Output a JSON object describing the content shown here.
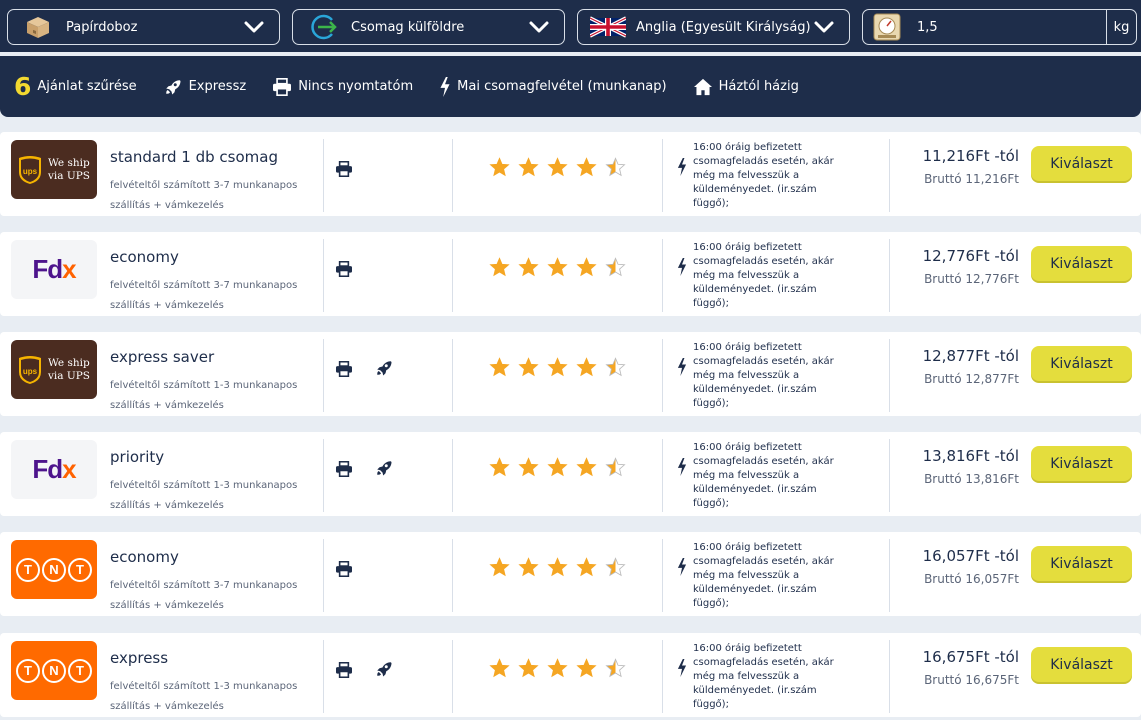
{
  "selectors": {
    "package_type": {
      "label": "Papírdoboz",
      "icon": "box-icon"
    },
    "route": {
      "label": "Csomag külföldre",
      "icon": "arrow-circle-icon"
    },
    "destination": {
      "label": "Anglia (Egyesült Királyság)",
      "icon": "uk-flag-icon"
    },
    "weight": {
      "value": "1,5",
      "unit": "kg",
      "icon": "scale-icon"
    }
  },
  "filters": {
    "count": "6",
    "title": "Ajánlat szűrése",
    "items": [
      {
        "label": "Expressz",
        "icon": "rocket-icon"
      },
      {
        "label": "Nincs nyomtatóm",
        "icon": "printer-icon"
      },
      {
        "label": "Mai csomagfelvétel (munkanap)",
        "icon": "bolt-icon"
      },
      {
        "label": "Háztól házig",
        "icon": "home-icon"
      }
    ]
  },
  "offers": [
    {
      "carrier": "UPS",
      "service": "standard 1 db csomag",
      "desc1": "felvételtől számított 3-7 munkanapos",
      "desc2": "szállítás + vámkezelés",
      "express": false,
      "rating": 4.5,
      "pickup": "16:00 óráig befizetett csomagfeladás esetén, akár még ma felvesszük a küldeményedet. (ir.szám függő);",
      "price": "11,216Ft -tól",
      "gross": "Bruttó 11,216Ft",
      "button": "Kiválaszt"
    },
    {
      "carrier": "FedEx",
      "service": "economy",
      "desc1": "felvételtől számított 3-7 munkanapos",
      "desc2": "szállítás + vámkezelés",
      "express": false,
      "rating": 4.5,
      "pickup": "16:00 óráig befizetett csomagfeladás esetén, akár még ma felvesszük a küldeményedet. (ir.szám függő);",
      "price": "12,776Ft -tól",
      "gross": "Bruttó 12,776Ft",
      "button": "Kiválaszt"
    },
    {
      "carrier": "UPS",
      "service": "express saver",
      "desc1": "felvételtől számított 1-3 munkanapos",
      "desc2": "szállítás + vámkezelés",
      "express": true,
      "rating": 4.5,
      "pickup": "16:00 óráig befizetett csomagfeladás esetén, akár még ma felvesszük a küldeményedet. (ir.szám függő);",
      "price": "12,877Ft -tól",
      "gross": "Bruttó 12,877Ft",
      "button": "Kiválaszt"
    },
    {
      "carrier": "FedEx",
      "service": "priority",
      "desc1": "felvételtől számított 1-3 munkanapos",
      "desc2": "szállítás + vámkezelés",
      "express": true,
      "rating": 4.5,
      "pickup": "16:00 óráig befizetett csomagfeladás esetén, akár még ma felvesszük a küldeményedet. (ir.szám függő);",
      "price": "13,816Ft -tól",
      "gross": "Bruttó 13,816Ft",
      "button": "Kiválaszt"
    },
    {
      "carrier": "TNT",
      "service": "economy",
      "desc1": "felvételtől számított 3-7 munkanapos",
      "desc2": "szállítás + vámkezelés",
      "express": false,
      "rating": 4.5,
      "pickup": "16:00 óráig befizetett csomagfeladás esetén, akár még ma felvesszük a küldeményedet. (ir.szám függő);",
      "price": "16,057Ft -tól",
      "gross": "Bruttó 16,057Ft",
      "button": "Kiválaszt"
    },
    {
      "carrier": "TNT",
      "service": "express",
      "desc1": "felvételtől számított 1-3 munkanapos",
      "desc2": "szállítás + vámkezelés",
      "express": true,
      "rating": 4.5,
      "pickup": "16:00 óráig befizetett csomagfeladás esetén, akár még ma felvesszük a küldeményedet. (ir.szám függő);",
      "price": "16,675Ft -tól",
      "gross": "Bruttó 16,675Ft",
      "button": "Kiválaszt"
    }
  ],
  "logos": {
    "ups_text_1": "We ship",
    "ups_text_2": "via UPS",
    "ups_shield": "ups",
    "fdx_fd": "Fd",
    "fdx_x": "x",
    "tnt": [
      "T",
      "N",
      "T"
    ]
  },
  "colors": {
    "navy": "#1e2d4a",
    "accent_yellow": "#e4dd3d",
    "star": "#f5a623",
    "ups_brown": "#4b2c20",
    "fedex_purple": "#4d148c",
    "fedex_orange": "#ff6200",
    "tnt_orange": "#ff6a00"
  }
}
